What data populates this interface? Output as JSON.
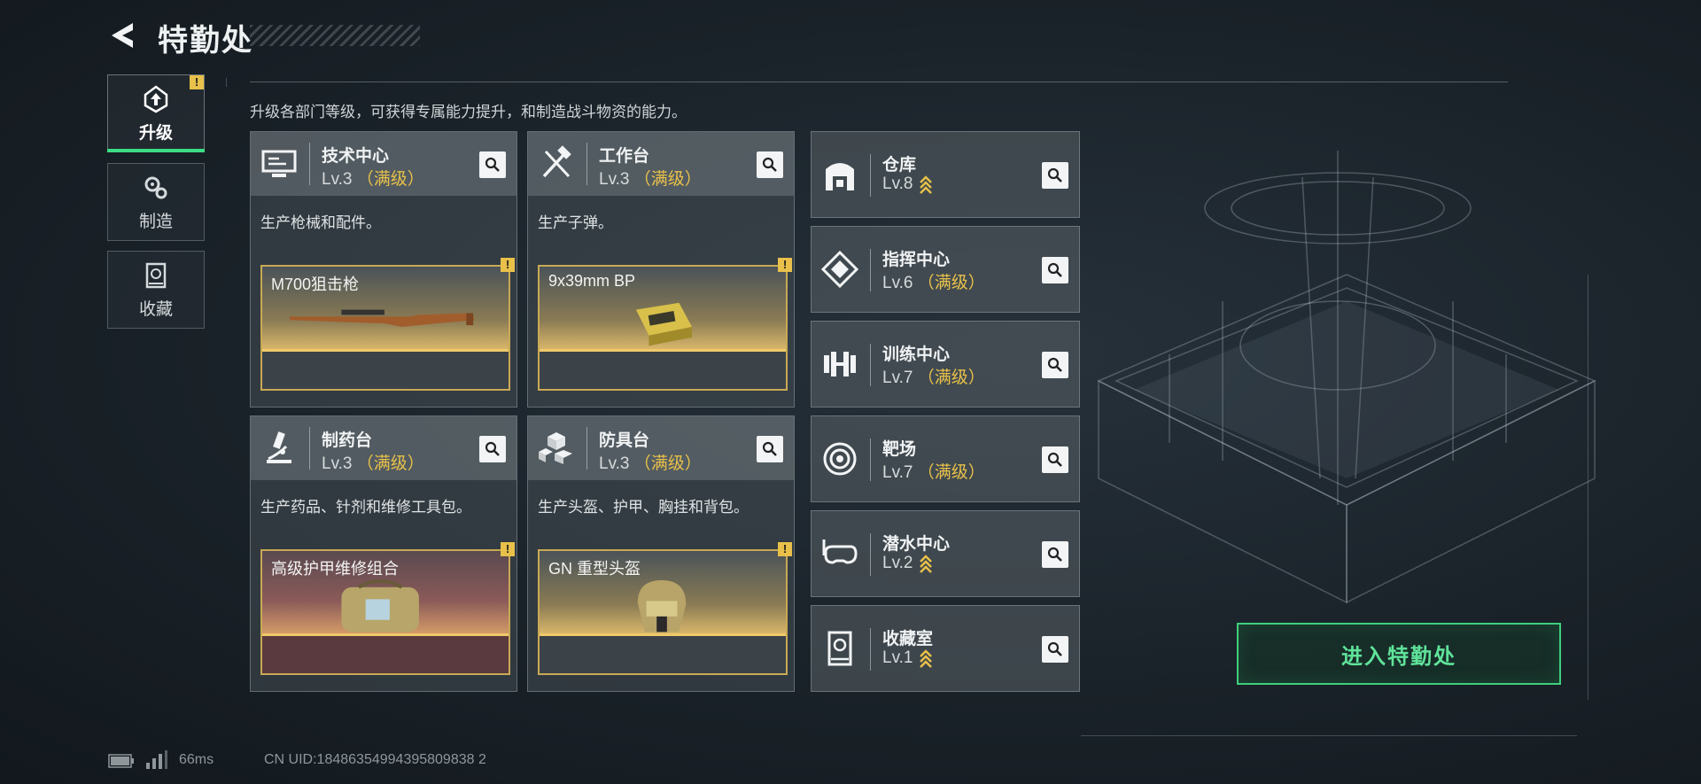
{
  "header": {
    "title": "特勤处"
  },
  "nav": [
    {
      "label": "升级",
      "icon": "upgrade-icon",
      "active": true,
      "alert": "!"
    },
    {
      "label": "制造",
      "icon": "gears-icon",
      "active": false
    },
    {
      "label": "收藏",
      "icon": "collection-icon",
      "active": false
    }
  ],
  "description": "升级各部门等级，可获得专属能力提升，和制造战斗物资的能力。",
  "cards": [
    {
      "name": "技术中心",
      "level": "Lv.3",
      "status": "（满级）",
      "desc": "生产枪械和配件。",
      "item": "M700狙击枪",
      "alert": "!",
      "icon": "computer-icon"
    },
    {
      "name": "工作台",
      "level": "Lv.3",
      "status": "（满级）",
      "desc": "生产子弹。",
      "item": "9x39mm BP",
      "alert": "!",
      "icon": "tools-icon"
    },
    {
      "name": "制药台",
      "level": "Lv.3",
      "status": "（满级）",
      "desc": "生产药品、针剂和维修工具包。",
      "item": "高级护甲维修组合",
      "alert": "!",
      "icon": "microscope-icon"
    },
    {
      "name": "防具台",
      "level": "Lv.3",
      "status": "（满级）",
      "desc": "生产头盔、护甲、胸挂和背包。",
      "item": "GN 重型头盔",
      "alert": "!",
      "icon": "armor-boxes-icon"
    }
  ],
  "small_cards": [
    {
      "name": "仓库",
      "level": "Lv.8",
      "status": "",
      "upgradable": true,
      "icon": "warehouse-icon"
    },
    {
      "name": "指挥中心",
      "level": "Lv.6",
      "status": "（满级）",
      "upgradable": false,
      "icon": "command-icon"
    },
    {
      "name": "训练中心",
      "level": "Lv.7",
      "status": "（满级）",
      "upgradable": false,
      "icon": "dumbbell-icon"
    },
    {
      "name": "靶场",
      "level": "Lv.7",
      "status": "（满级）",
      "upgradable": false,
      "icon": "target-icon"
    },
    {
      "name": "潜水中心",
      "level": "Lv.2",
      "status": "",
      "upgradable": true,
      "icon": "diving-mask-icon"
    },
    {
      "name": "收藏室",
      "level": "Lv.1",
      "status": "",
      "upgradable": true,
      "icon": "collection-room-icon"
    }
  ],
  "enter_button": "进入特勤处",
  "footer": {
    "ping": "66ms",
    "uid": "CN UID:18486354994395809838 2"
  },
  "colors": {
    "accent_green": "#3ddc84",
    "gold": "#e8c04a"
  }
}
